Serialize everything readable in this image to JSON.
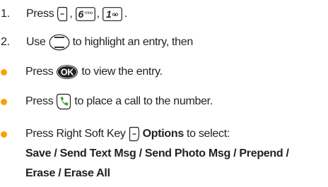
{
  "colors": {
    "text": "#231f20",
    "bullet": "#f5a300"
  },
  "step1": {
    "number": "1.",
    "text": "Press",
    "sep1": ",",
    "sep2": ",",
    "end": "."
  },
  "step2": {
    "number": "2.",
    "text_a": "Use",
    "text_b": "to highlight an entry, then"
  },
  "bullet1": {
    "text_a": "Press",
    "text_b": "to view the entry."
  },
  "bullet2": {
    "text_a": "Press",
    "text_b": "to place a call to the number."
  },
  "bullet3": {
    "text_a": "Press Right Soft Key",
    "options": "Options",
    "text_b": "to select:",
    "line2": "Save / Send Text Msg / Send Photo Msg / Prepend /",
    "line3": "Erase / Erase All"
  },
  "keys": {
    "six": "6",
    "six_sub": "mno",
    "one": "1",
    "ok": "OK"
  },
  "icons": [
    "left-soft-key-icon",
    "key-6-mno-icon",
    "key-1-voicemail-icon",
    "nav-key-icon",
    "ok-key-icon",
    "send-key-icon",
    "right-soft-key-icon"
  ]
}
